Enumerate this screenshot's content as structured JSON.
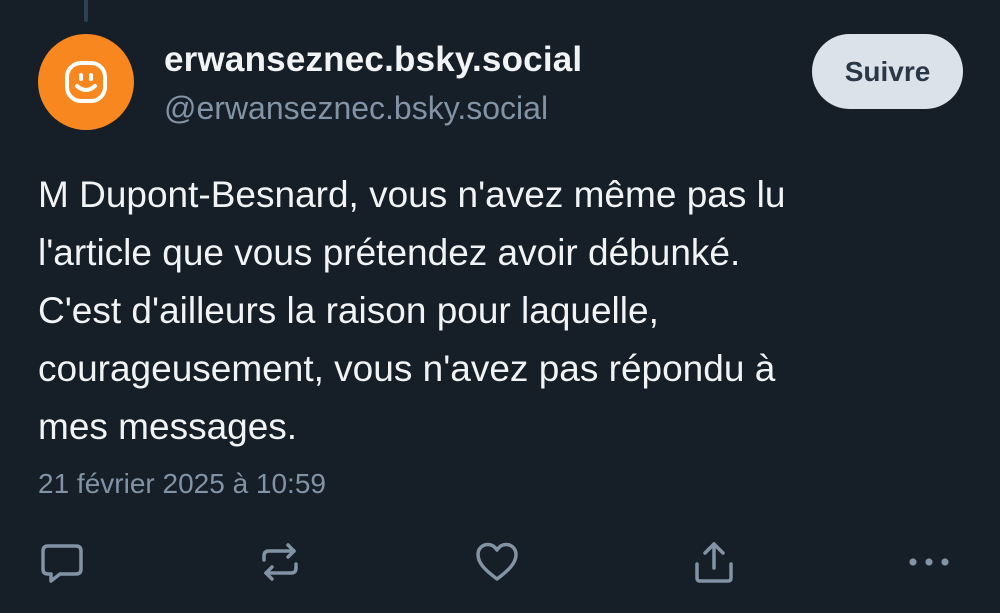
{
  "post": {
    "author": {
      "display_name": "erwanseznec.bsky.social",
      "handle": "@erwanseznec.bsky.social",
      "avatar_icon": "smiley-face-icon",
      "avatar_color": "#f7871e"
    },
    "follow_label": "Suivre",
    "text_lines": [
      "M Dupont-Besnard, vous n'avez même pas lu",
      "l'article que vous prétendez avoir débunké.",
      "C'est d'ailleurs la raison pour laquelle,",
      "courageusement, vous n'avez pas répondu à",
      "mes messages."
    ],
    "timestamp": "21 février 2025 à 10:59"
  },
  "actions": [
    {
      "name": "reply",
      "icon": "reply-icon"
    },
    {
      "name": "repost",
      "icon": "repost-icon"
    },
    {
      "name": "like",
      "icon": "heart-icon"
    },
    {
      "name": "share",
      "icon": "share-icon"
    },
    {
      "name": "more",
      "icon": "more-options-icon"
    }
  ],
  "colors": {
    "background": "#161e27",
    "text_primary": "#f1f3f5",
    "text_secondary": "#8293a5",
    "button_bg": "#dce2ea",
    "button_text": "#2a3747",
    "icon": "#8293a5"
  }
}
